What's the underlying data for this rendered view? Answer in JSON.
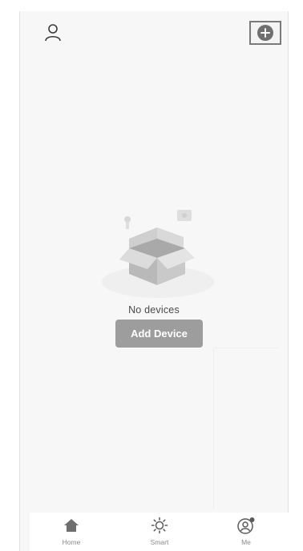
{
  "header": {
    "user_icon": "user-icon",
    "add_icon": "plus-circle-icon"
  },
  "empty_state": {
    "illustration": "empty-box-illustration",
    "message": "No devices",
    "add_device_label": "Add Device"
  },
  "tab_bar": {
    "tabs": [
      {
        "label": "Home",
        "icon": "home-icon"
      },
      {
        "label": "Smart",
        "icon": "sun-icon"
      },
      {
        "label": "Me",
        "icon": "profile-icon"
      }
    ]
  },
  "colors": {
    "background": "#f7f7f7",
    "button": "#9d9d9d",
    "icon": "#6f6f6f"
  }
}
